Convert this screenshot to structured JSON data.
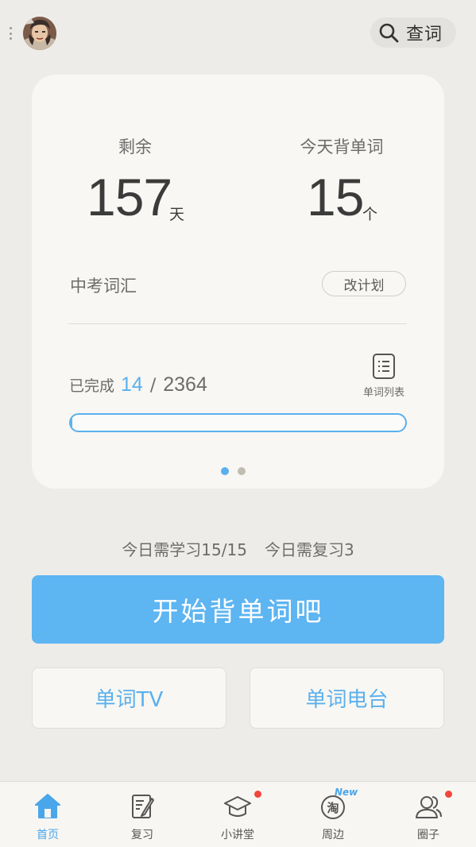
{
  "header": {
    "search_label": "查词",
    "icons": {
      "menu": "more-vertical-icon",
      "avatar": "user-avatar",
      "search": "search-icon"
    }
  },
  "plan_card": {
    "days_left_label": "剩余",
    "days_left_value": "157",
    "days_unit": "天",
    "daily_words_label": "今天背单词",
    "daily_words_value": "15",
    "words_unit": "个",
    "book_name": "中考词汇",
    "change_plan_label": "改计划",
    "progress_prefix": "已完成",
    "progress_done": "14",
    "progress_separator": "/",
    "progress_total": "2364",
    "progress_fraction": 0.0059,
    "word_list_label": "单词列表",
    "page_indicator": {
      "count": 2,
      "active": 0
    }
  },
  "today": {
    "study_text": "今日需学习15/15",
    "review_text": "今日需复习3"
  },
  "actions": {
    "start_label": "开始背单词吧",
    "tv_label": "单词TV",
    "radio_label": "单词电台"
  },
  "bottom_nav": {
    "items": [
      {
        "label": "首页",
        "icon": "home-icon",
        "active": true
      },
      {
        "label": "复习",
        "icon": "edit-note-icon",
        "active": false
      },
      {
        "label": "小讲堂",
        "icon": "graduation-cap-icon",
        "active": false,
        "has_dot": true
      },
      {
        "label": "周边",
        "icon": "taobao-icon",
        "active": false,
        "badge": "New"
      },
      {
        "label": "圈子",
        "icon": "people-icon",
        "active": false,
        "has_dot": true
      }
    ]
  },
  "colors": {
    "accent": "#5DB5F1",
    "background": "#EDECE8",
    "card": "#F8F7F3",
    "notification": "#F2453D"
  }
}
